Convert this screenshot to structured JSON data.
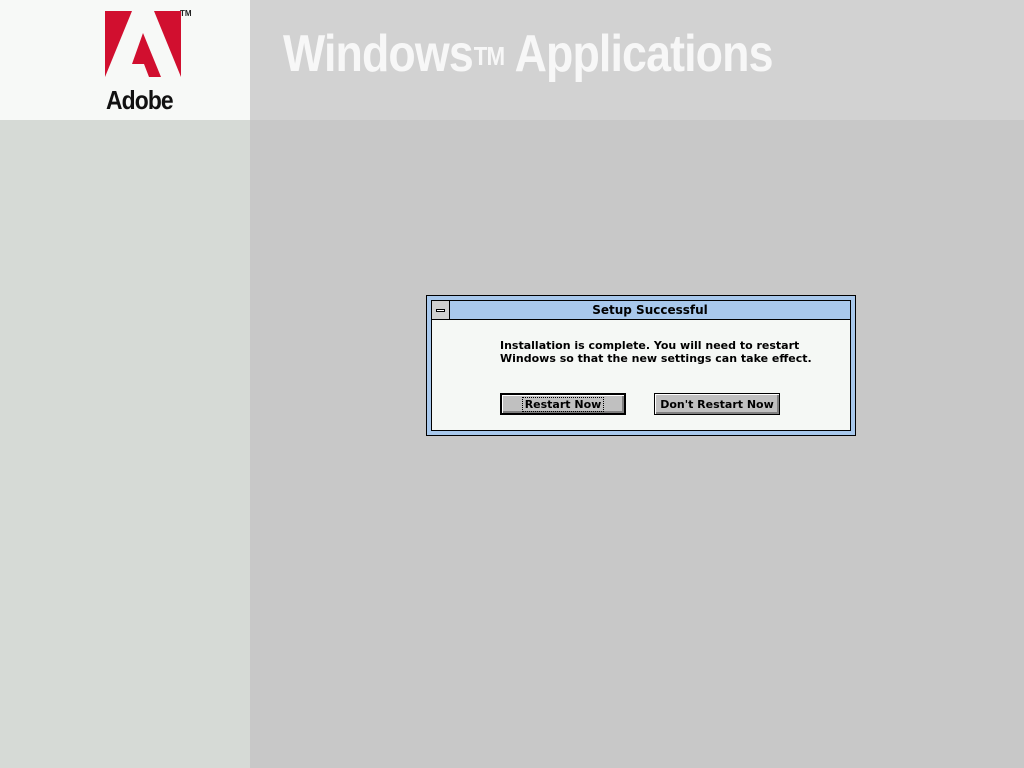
{
  "header": {
    "logo_text": "Adobe",
    "logo_tm": "TM",
    "title_part1": "Windows",
    "title_tm": "TM",
    "title_part2": "Applications"
  },
  "colors": {
    "logo_red": "#d10f2f",
    "dialog_frame": "#a8c8ec",
    "dialog_body": "#f5f8f5",
    "desktop": "#c8c8c8",
    "left_column": "#d6dad6"
  },
  "dialog": {
    "title": "Setup Successful",
    "system_menu_icon": "system-menu-icon",
    "message_line1": "Installation is complete.  You will need to restart",
    "message_line2": "Windows so that the new settings can take effect.",
    "buttons": {
      "restart": "Restart Now",
      "dont_restart": "Don't Restart Now"
    }
  }
}
